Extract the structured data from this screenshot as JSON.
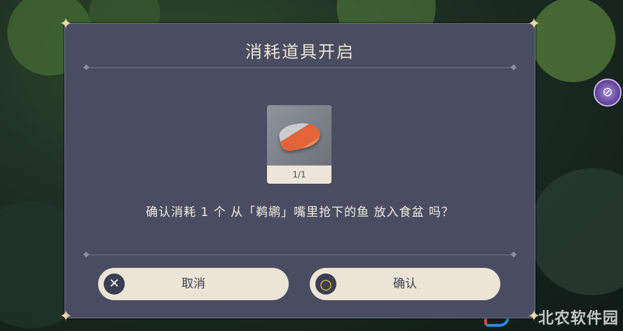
{
  "dialog": {
    "title": "消耗道具开启",
    "item": {
      "count": "1/1",
      "icon": "fish-icon"
    },
    "question": "确认消耗 1 个 从「鹈鹕」嘴里抢下的鱼 放入食盆 吗？",
    "cancel_label": "取消",
    "confirm_label": "确认",
    "cancel_icon": "✕",
    "confirm_icon": "○"
  },
  "background": {
    "side_icon": "⊘"
  },
  "watermark": {
    "text": "北农软件园"
  }
}
